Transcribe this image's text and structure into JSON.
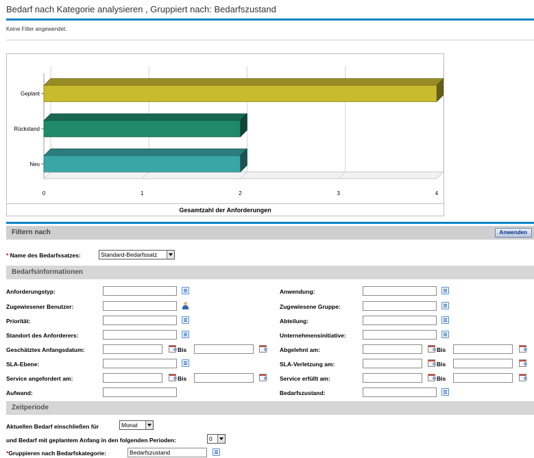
{
  "page": {
    "title": "Bedarf nach Kategorie analysieren , Gruppiert nach: Bedarfszustand",
    "no_filter": "Keine Filter angewendet."
  },
  "chart_data": {
    "type": "bar",
    "orientation": "horizontal",
    "categories": [
      "Geplant",
      "Rückstand",
      "Neu"
    ],
    "values": [
      4,
      2,
      2
    ],
    "colors": [
      "#c9bb2e",
      "#1e8a69",
      "#3aa6a6"
    ],
    "xlabel": "Gesamtzahl der Anforderungen",
    "xlim": [
      0,
      4
    ],
    "xticks": [
      "0",
      "1",
      "2",
      "3",
      "4"
    ],
    "grid": true
  },
  "filter": {
    "header": "Filtern nach",
    "apply_label": "Anwenden",
    "demand_set_label": "Name des Bedarfssatzes:",
    "demand_set_value": "Standard-Bedarfssatz"
  },
  "demand_info": {
    "header": "Bedarfsinformationen",
    "request_type": "Anforderungstyp:",
    "assigned_user": "Zugewiesener Benutzer:",
    "priority": "Priorität:",
    "requestor_location": "Standort des Anforderers:",
    "est_start": "Geschätztes Anfangsdatum:",
    "sla_level": "SLA-Ebene:",
    "service_requested": "Service angefordert am:",
    "effort": "Aufwand:",
    "application": "Anwendung:",
    "assigned_group": "Zugewiesene Gruppe:",
    "department": "Abteilung:",
    "initiative": "Unternehmensinitiative:",
    "rejected": "Abgelehnt am:",
    "sla_violation": "SLA-Verletzung am:",
    "service_fulfilled": "Service erfüllt am:",
    "demand_state": "Bedarfszustand:",
    "bis": "Bis"
  },
  "time_period": {
    "header": "Zeitperiode",
    "include_label": "Aktuellen Bedarf einschließen für",
    "include_value": "Monat",
    "planned_label": "und Bedarf mit geplantem Anfang in den folgenden Perioden:",
    "planned_value": "0",
    "group_label": "Gruppieren nach Bedarfskategorie:",
    "group_value": "Bedarfszustand"
  }
}
